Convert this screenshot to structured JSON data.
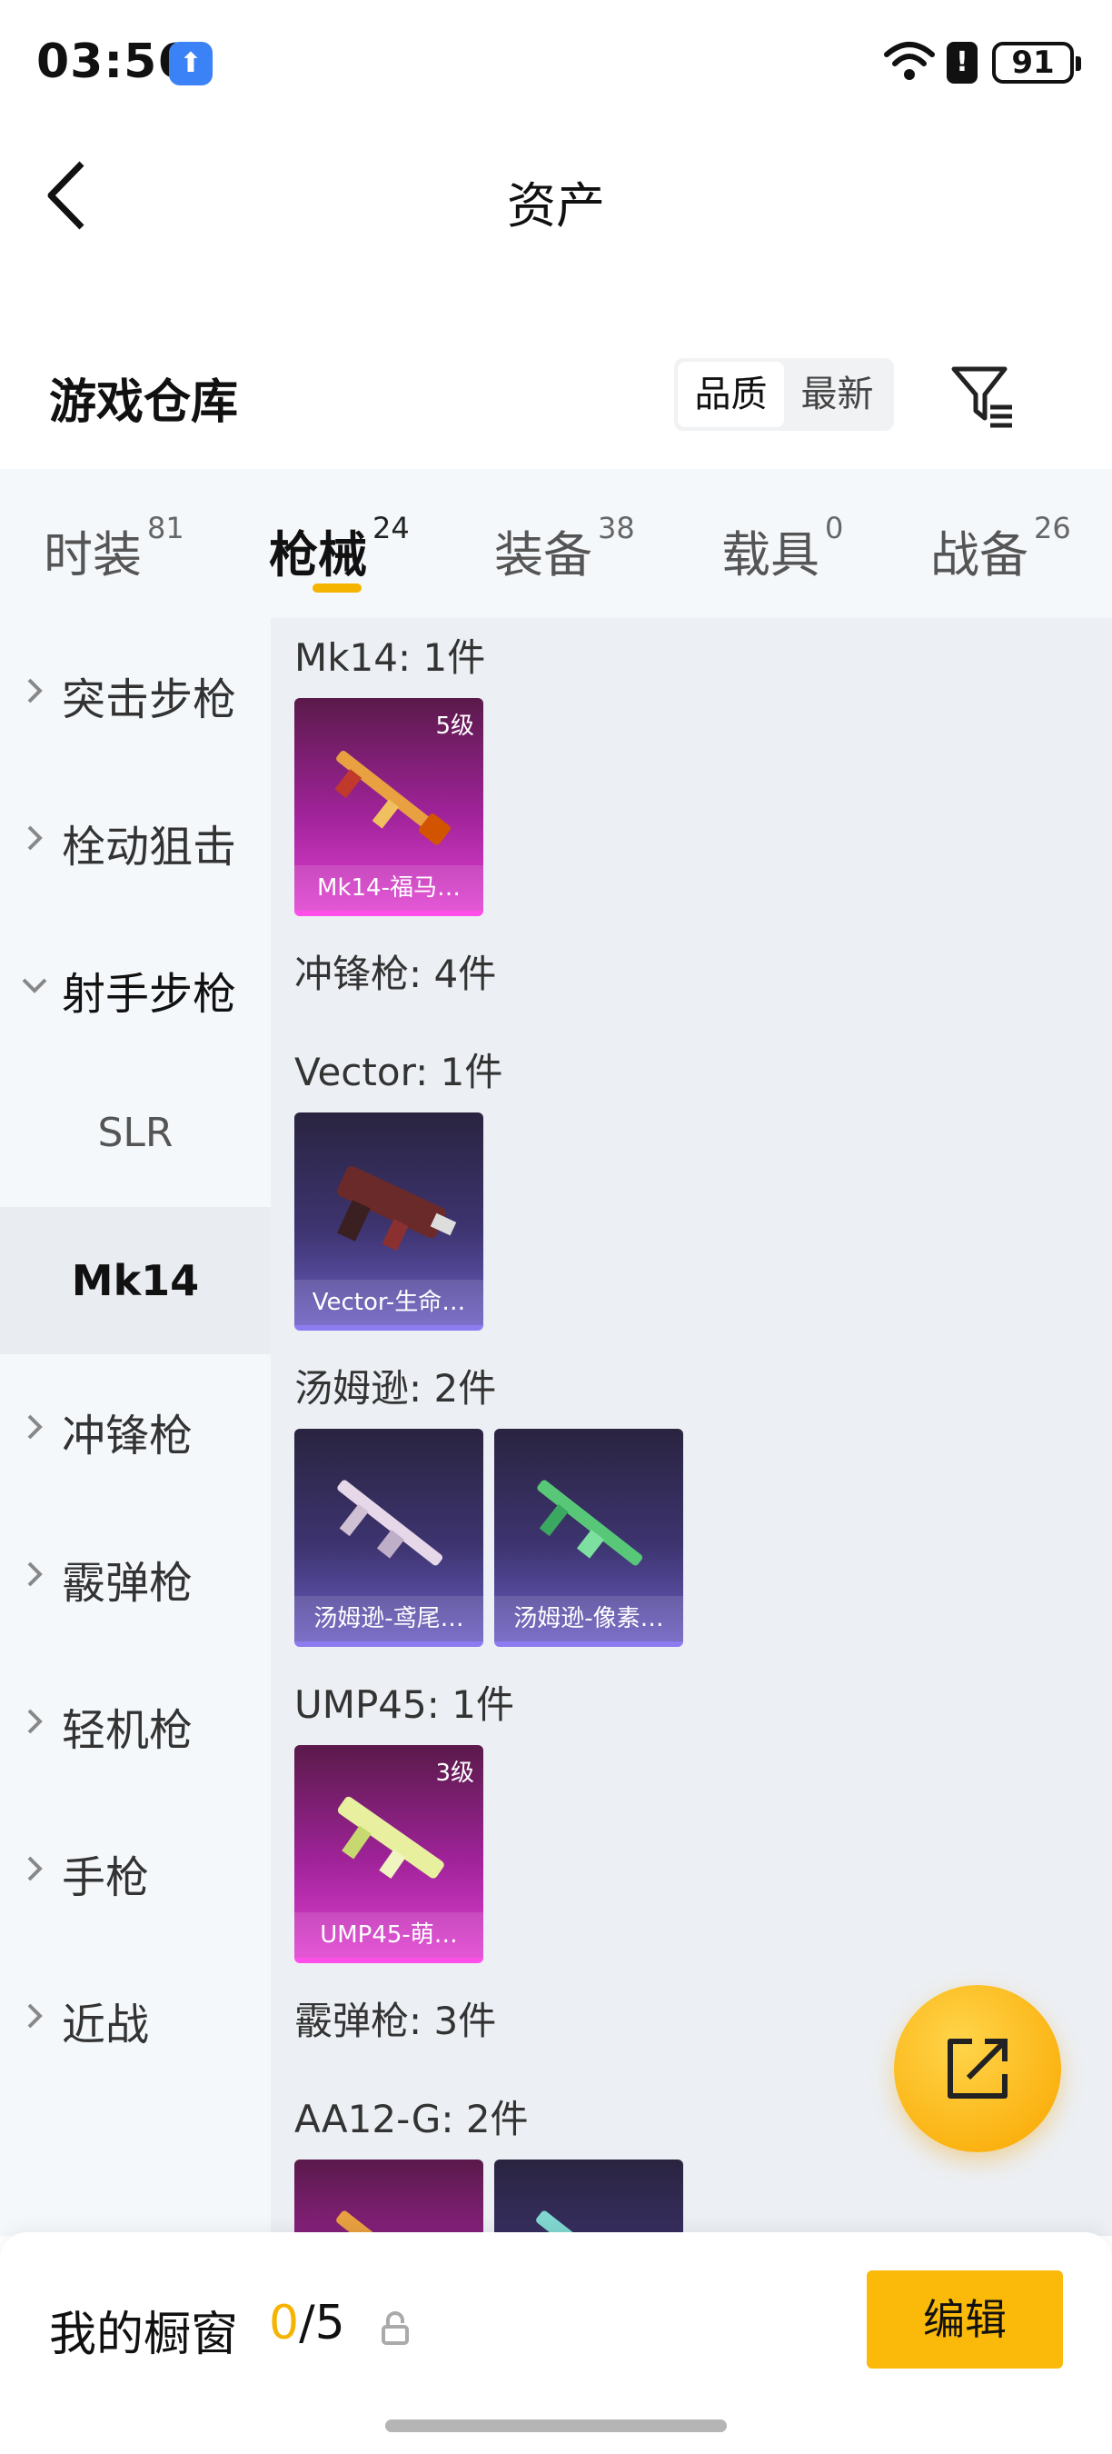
{
  "status_bar": {
    "time": "03:56",
    "battery": "91",
    "app_icon": "upload-arrow-icon",
    "wifi_icon": "wifi-icon",
    "alert_icon": "battery-alert-icon"
  },
  "header": {
    "title": "资产",
    "back_icon": "chevron-left-icon"
  },
  "section": {
    "title": "游戏仓库",
    "sort_options": [
      "品质",
      "最新"
    ],
    "active_sort": "品质",
    "filter_icon": "filter-icon"
  },
  "tabs": [
    {
      "label": "时装",
      "count": "81"
    },
    {
      "label": "枪械",
      "count": "24",
      "active": true
    },
    {
      "label": "装备",
      "count": "38"
    },
    {
      "label": "载具",
      "count": "0"
    },
    {
      "label": "战备",
      "count": "26"
    }
  ],
  "sidebar": [
    {
      "label": "突击步枪",
      "state": "collapsed"
    },
    {
      "label": "栓动狙击",
      "state": "collapsed"
    },
    {
      "label": "射手步枪",
      "state": "expanded"
    },
    {
      "label": "SLR",
      "sub": true
    },
    {
      "label": "Mk14",
      "sub": true,
      "selected": true
    },
    {
      "label": "冲锋枪",
      "state": "collapsed"
    },
    {
      "label": "霰弹枪",
      "state": "collapsed"
    },
    {
      "label": "轻机枪",
      "state": "collapsed"
    },
    {
      "label": "手枪",
      "state": "collapsed"
    },
    {
      "label": "近战",
      "state": "collapsed"
    }
  ],
  "content": {
    "groups": [
      {
        "label": "Mk14: 1件",
        "items": [
          {
            "name": "Mk14-福马…",
            "level": "5级",
            "rarity": "gold"
          }
        ]
      },
      {
        "label": "冲锋枪: 4件",
        "items": []
      },
      {
        "label": "Vector: 1件",
        "items": [
          {
            "name": "Vector-生命…",
            "level": "",
            "rarity": "purple"
          }
        ]
      },
      {
        "label": "汤姆逊: 2件",
        "items": [
          {
            "name": "汤姆逊-鸢尾…",
            "level": "",
            "rarity": "purple"
          },
          {
            "name": "汤姆逊-像素…",
            "level": "",
            "rarity": "purple"
          }
        ]
      },
      {
        "label": "UMP45: 1件",
        "items": [
          {
            "name": "UMP45-萌…",
            "level": "3级",
            "rarity": "gold"
          }
        ]
      },
      {
        "label": "霰弹枪: 3件",
        "items": []
      },
      {
        "label": "AA12-G: 2件",
        "items": [
          {
            "name": "",
            "level": "",
            "rarity": "gold"
          },
          {
            "name": "",
            "level": "",
            "rarity": "purple"
          }
        ]
      }
    ]
  },
  "fab": {
    "icon": "share-external-icon"
  },
  "bottom_bar": {
    "label": "我的橱窗",
    "used": "0",
    "total": "/5",
    "lock_icon": "lock-icon",
    "edit_label": "编辑"
  },
  "colors": {
    "accent": "#f5b400",
    "edit_button": "#fbb90a",
    "gold_card": "#a0239a",
    "purple_card": "#3d3470"
  }
}
